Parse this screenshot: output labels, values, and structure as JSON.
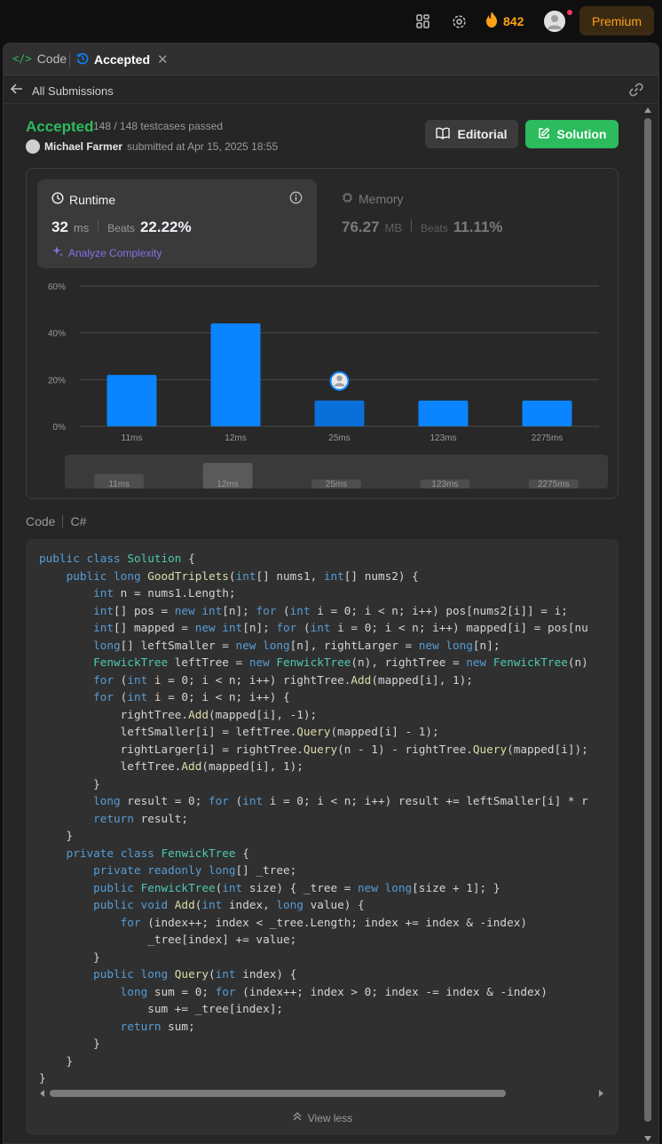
{
  "topbar": {
    "icons": [
      "apps-grid-icon",
      "gear-icon",
      "flame-icon",
      "avatar",
      "notification-dot"
    ],
    "streak_count": "842",
    "premium_label": "Premium",
    "colors": {
      "accent": "#ffa116",
      "notification": "#ff375f"
    }
  },
  "tabs": {
    "code_label": "Code",
    "accepted_label": "Accepted"
  },
  "subbar": {
    "back_label": "All Submissions"
  },
  "submission": {
    "status": "Accepted",
    "testcases": "148 / 148 testcases passed",
    "user": "Michael Farmer",
    "submitted_text": "submitted at Apr 15, 2025 18:55",
    "editorial_label": "Editorial",
    "solution_label": "Solution",
    "colors": {
      "success": "#2cbb5d"
    }
  },
  "runtime": {
    "label": "Runtime",
    "value": "32",
    "unit": "ms",
    "beats_label": "Beats",
    "beats_value": "22.22%",
    "analyze_label": "Analyze Complexity"
  },
  "memory": {
    "label": "Memory",
    "value": "76.27",
    "unit": "MB",
    "beats_label": "Beats",
    "beats_value": "11.11%"
  },
  "chart_data": {
    "type": "bar",
    "categories": [
      "11ms",
      "12ms",
      "25ms",
      "123ms",
      "2275ms"
    ],
    "values": [
      22,
      44,
      11,
      11,
      11
    ],
    "ylim": [
      0,
      60
    ],
    "yticks": [
      "60%",
      "40%",
      "20%",
      "0%"
    ],
    "ytick_values": [
      60,
      40,
      20,
      0
    ],
    "highlight_index": 2,
    "grid": true,
    "colors": {
      "bar": "#0a84ff",
      "bar_highlight": "#0a6fd9"
    }
  },
  "code": {
    "header_label": "Code",
    "language": "C#",
    "lines": [
      "public class Solution {",
      "    public long GoodTriplets(int[] nums1, int[] nums2) {",
      "        int n = nums1.Length;",
      "        int[] pos = new int[n]; for (int i = 0; i < n; i++) pos[nums2[i]] = i;",
      "        int[] mapped = new int[n]; for (int i = 0; i < n; i++) mapped[i] = pos[nu",
      "        long[] leftSmaller = new long[n], rightLarger = new long[n];",
      "        FenwickTree leftTree = new FenwickTree(n), rightTree = new FenwickTree(n)",
      "        for (int i = 0; i < n; i++) rightTree.Add(mapped[i], 1);",
      "        for (int i = 0; i < n; i++) {",
      "            rightTree.Add(mapped[i], -1);",
      "            leftSmaller[i] = leftTree.Query(mapped[i] - 1);",
      "            rightLarger[i] = rightTree.Query(n - 1) - rightTree.Query(mapped[i]);",
      "            leftTree.Add(mapped[i], 1);",
      "        }",
      "        long result = 0; for (int i = 0; i < n; i++) result += leftSmaller[i] * r",
      "        return result;",
      "    }",
      "    private class FenwickTree {",
      "        private readonly long[] _tree;",
      "        public FenwickTree(int size) { _tree = new long[size + 1]; }",
      "        public void Add(int index, long value) {",
      "            for (index++; index < _tree.Length; index += index & -index)",
      "                _tree[index] += value;",
      "        }",
      "        public long Query(int index) {",
      "            long sum = 0; for (index++; index > 0; index -= index & -index)",
      "                sum += _tree[index];",
      "            return sum;",
      "        }",
      "    }",
      "}"
    ],
    "view_less_label": "View less"
  }
}
